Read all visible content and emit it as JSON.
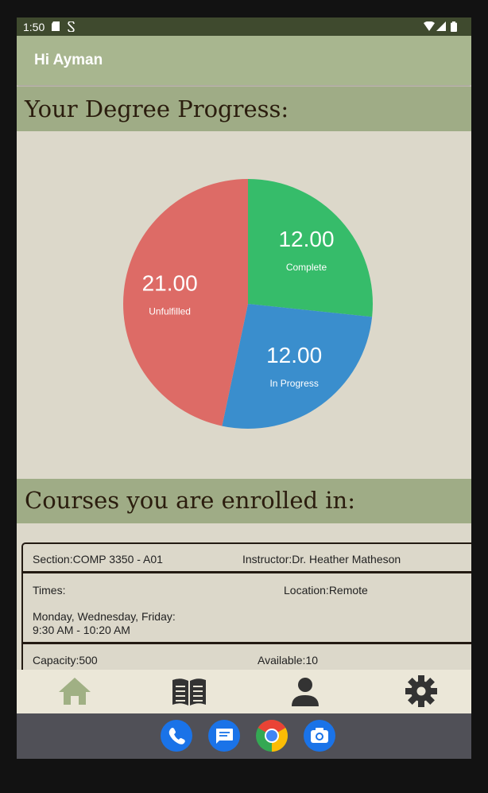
{
  "status_bar": {
    "time": "1:50"
  },
  "app_bar": {
    "greeting": "Hi Ayman"
  },
  "progress_section": {
    "title": "Your Degree Progress:"
  },
  "chart_data": {
    "type": "pie",
    "slices": [
      {
        "label": "Complete",
        "value": 12.0,
        "display": "12.00",
        "color": "#36bc6a"
      },
      {
        "label": "In Progress",
        "value": 12.0,
        "display": "12.00",
        "color": "#3a8ecd"
      },
      {
        "label": "Unfulfilled",
        "value": 21.0,
        "display": "21.00",
        "color": "#dd6b66"
      }
    ]
  },
  "courses_section": {
    "title": "Courses you are enrolled in:"
  },
  "course": {
    "section": "Section:COMP 3350 - A01",
    "instructor": "Instructor:Dr. Heather Matheson",
    "times_label": "Times:",
    "location": "Location:Remote",
    "days": "Monday, Wednesday, Friday:",
    "hours": "9:30 AM - 10:20 AM",
    "capacity": "Capacity:500",
    "available": "Available:10"
  },
  "bottom_nav": {
    "items": [
      {
        "icon": "home-icon",
        "active": true
      },
      {
        "icon": "book-icon",
        "active": false
      },
      {
        "icon": "person-icon",
        "active": false
      },
      {
        "icon": "gear-icon",
        "active": false
      }
    ],
    "active_color": "#a0b084",
    "inactive_color": "#333333"
  },
  "dock": {
    "apps": [
      "phone-icon",
      "messages-icon",
      "chrome-icon",
      "camera-icon"
    ]
  }
}
